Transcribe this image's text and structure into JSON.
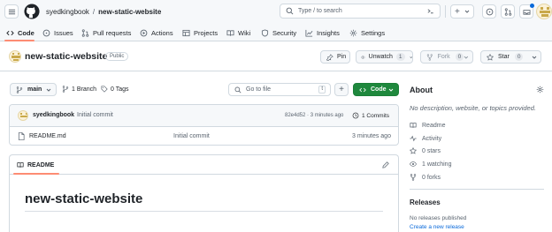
{
  "header": {
    "owner": "syedkingbook",
    "separator": "/",
    "repo": "new-static-website",
    "search_placeholder": "Type / to search",
    "add_label": "+",
    "icons": [
      "github-logo-icon",
      "menu-icon",
      "search-icon",
      "terminal-icon",
      "plus-icon",
      "issue-icon",
      "pull-request-icon",
      "inbox-icon",
      "avatar"
    ]
  },
  "tabs": [
    {
      "label": "Code",
      "icon": "code-icon",
      "active": true
    },
    {
      "label": "Issues",
      "icon": "issue-icon"
    },
    {
      "label": "Pull requests",
      "icon": "pull-request-icon"
    },
    {
      "label": "Actions",
      "icon": "play-icon"
    },
    {
      "label": "Projects",
      "icon": "table-icon"
    },
    {
      "label": "Wiki",
      "icon": "book-icon"
    },
    {
      "label": "Security",
      "icon": "shield-icon"
    },
    {
      "label": "Insights",
      "icon": "graph-icon"
    },
    {
      "label": "Settings",
      "icon": "gear-icon"
    }
  ],
  "repo": {
    "name": "new-static-website",
    "visibility": "Public",
    "pin_label": "Pin",
    "unwatch_label": "Unwatch",
    "watch_count": "1",
    "fork_label": "Fork",
    "fork_count": "0",
    "star_label": "Star",
    "star_count": "0"
  },
  "filebar": {
    "branch": "main",
    "branches": "1 Branch",
    "tags": "0 Tags",
    "goto_placeholder": "Go to file",
    "goto_shortcut": "t",
    "add_label": "+",
    "code_label": "Code"
  },
  "commit": {
    "author": "syedkingbook",
    "message": "Initial commit",
    "hash_time": "82e4d52 · 3 minutes ago",
    "commits_label": "1 Commits"
  },
  "files": [
    {
      "name": "README.md",
      "message": "Initial commit",
      "time": "3 minutes ago"
    }
  ],
  "readme": {
    "tab_label": "README",
    "heading": "new-static-website"
  },
  "about": {
    "title": "About",
    "description": "No description, website, or topics provided.",
    "items": [
      {
        "label": "Readme",
        "icon": "book-icon"
      },
      {
        "label": "Activity",
        "icon": "pulse-icon"
      },
      {
        "label": "0 stars",
        "icon": "star-icon"
      },
      {
        "label": "1 watching",
        "icon": "eye-icon"
      },
      {
        "label": "0 forks",
        "icon": "fork-icon"
      }
    ]
  },
  "releases": {
    "title": "Releases",
    "none_label": "No releases published",
    "create_link": "Create a new release"
  },
  "colors": {
    "accent": "#0969da",
    "code_button": "#1f883d",
    "tab_underline": "#fd8c73",
    "border": "#d1d9e0"
  }
}
